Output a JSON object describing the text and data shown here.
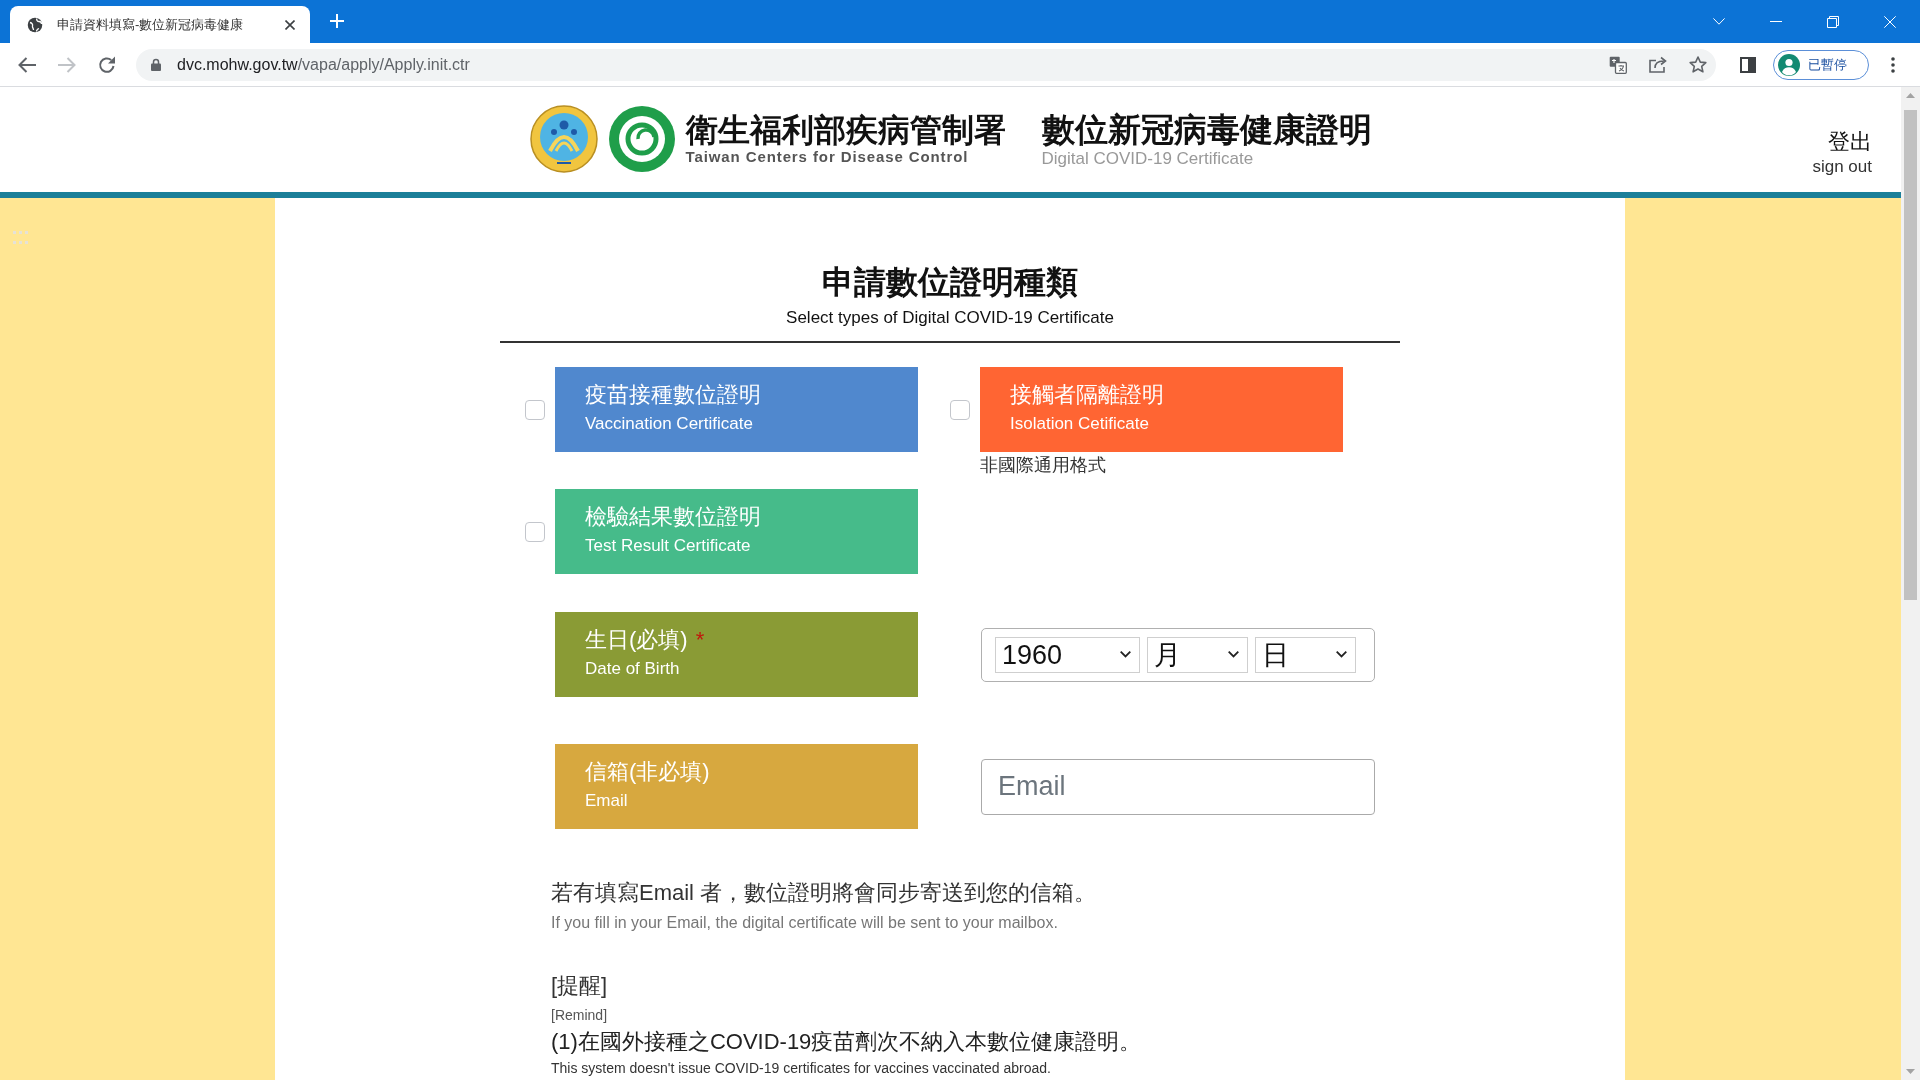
{
  "browser": {
    "tabs": [
      {
        "title": "申請資料填寫-數位新冠病毒健康",
        "selected": true
      }
    ],
    "nav_buttons": [
      {
        "kind": "back",
        "disabled": false
      },
      {
        "kind": "forward",
        "disabled": true
      },
      {
        "kind": "reload",
        "disabled": false
      }
    ],
    "address": {
      "host": "dvc.mohw.gov.tw",
      "path": "/vapa/apply/Apply.init.ctr"
    },
    "profile": {
      "status": "已暫停"
    }
  },
  "header": {
    "agency": {
      "name": "衛生福利部疾病管制署",
      "name_en": "Taiwan Centers for Disease Control"
    },
    "site": {
      "title": "數位新冠病毒健康證明",
      "title_en": "Digital COVID-19 Certificate"
    },
    "sign_out": {
      "label": "登出",
      "label_en": "sign out"
    }
  },
  "form": {
    "title": "申請數位證明種類",
    "subtitle": "Select types of Digital COVID-19 Certificate",
    "certificate_types": [
      {
        "label": "疫苗接種數位證明",
        "label_en": "Vaccination Certificate",
        "color": "#5088ce",
        "checked": false
      },
      {
        "label": "接觸者隔離證明",
        "label_en": "Isolation Cetificate",
        "color": "#ff6533",
        "checked": false,
        "note": "非國際通用格式"
      },
      {
        "label": "檢驗結果數位證明",
        "label_en": "Test Result Certificate",
        "color": "#46bb8a",
        "checked": false
      }
    ],
    "fields": [
      {
        "kind": "date",
        "label": "生日(必填)",
        "required_mark": "*",
        "label_en": "Date of Birth",
        "color": "#8a9b35",
        "selects": [
          {
            "kind": "year",
            "value": "1960"
          },
          {
            "kind": "month",
            "value": "月"
          },
          {
            "kind": "day",
            "value": "日"
          }
        ]
      },
      {
        "kind": "email",
        "label": "信箱(非必填)",
        "label_en": "Email",
        "color": "#d7a83f",
        "placeholder": "Email"
      }
    ],
    "email_hint": {
      "text": "若有填寫Email 者，數位證明將會同步寄送到您的信箱。",
      "text_en": "If you fill in your Email, the digital certificate will be sent to your mailbox."
    },
    "reminder": {
      "title": "[提醒]",
      "title_en": "[Remind]",
      "items": [
        {
          "text": "(1)在國外接種之COVID-19疫苗劑次不納入本數位健康證明。",
          "text_en": "This system doesn't issue COVID-19 certificates for vaccines vaccinated abroad."
        }
      ]
    }
  }
}
